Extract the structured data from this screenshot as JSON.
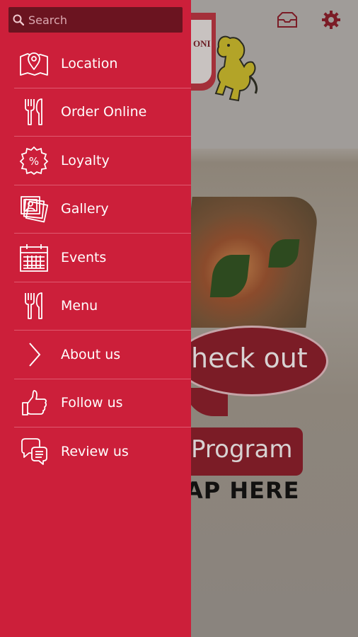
{
  "search": {
    "placeholder": "Search"
  },
  "menu": {
    "items": [
      {
        "label": "Location",
        "icon": "map-pin-icon"
      },
      {
        "label": "Order Online",
        "icon": "fork-knife-icon"
      },
      {
        "label": "Loyalty",
        "icon": "percent-badge-icon"
      },
      {
        "label": "Gallery",
        "icon": "photo-stack-icon"
      },
      {
        "label": "Events",
        "icon": "calendar-icon"
      },
      {
        "label": "Menu",
        "icon": "fork-knife-icon"
      },
      {
        "label": "About us",
        "icon": "chevron-right-icon"
      },
      {
        "label": "Follow us",
        "icon": "thumbs-up-icon"
      },
      {
        "label": "Review us",
        "icon": "chat-bubbles-icon"
      }
    ]
  },
  "background": {
    "logo_text": "ONI",
    "banner_line1": "heck out",
    "banner_line2": "Program",
    "banner_line3": "AP HERE"
  },
  "header": {
    "inbox_icon": "inbox-icon",
    "settings_icon": "gear-icon"
  },
  "colors": {
    "drawer": "#cc1f3a",
    "search_bg": "#6b1420",
    "accent": "#8b1a2a",
    "divider": "#df5a70"
  }
}
